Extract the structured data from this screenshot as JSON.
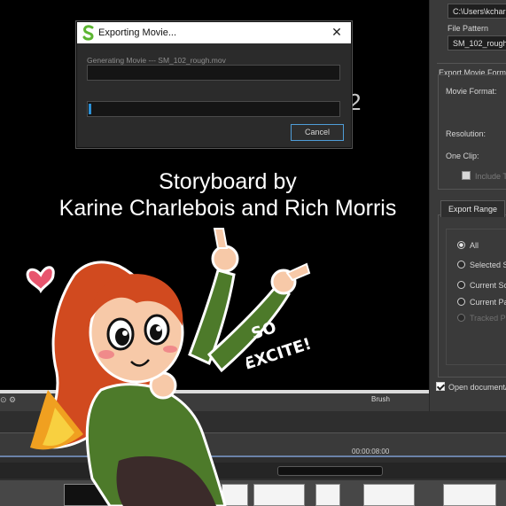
{
  "dialog": {
    "title": "Exporting Movie...",
    "status": "Generating Movie --- SM_102_rough.mov",
    "progress_primary": 0,
    "progress_secondary": 0.01,
    "cancel_label": "Cancel"
  },
  "viewer": {
    "credit_line1": "Storyboard by",
    "credit_line2": "Karine Charlebois and Rich Morris",
    "background_digit": "2"
  },
  "sticker": {
    "caption_line1": "SO",
    "caption_line2": "EXCITE!"
  },
  "export_panel": {
    "path_value": "C:\\Users\\kcharle",
    "file_pattern_label": "File Pattern",
    "file_pattern_value": "SM_102_rough",
    "export_movie_format_label": "Export Movie Forma",
    "movie_format_label": "Movie Format:",
    "resolution_label": "Resolution:",
    "one_clip_label": "One Clip:",
    "include_label": "Include T",
    "export_range_tab": "Export Range",
    "range_options": [
      {
        "label": "All",
        "checked": true,
        "enabled": true
      },
      {
        "label": "Selected S",
        "checked": false,
        "enabled": true
      },
      {
        "label": "Current Sc",
        "checked": false,
        "enabled": true
      },
      {
        "label": "Current Pa",
        "checked": false,
        "enabled": true
      },
      {
        "label": "Tracked Pa",
        "checked": false,
        "enabled": false
      }
    ],
    "open_document_label": "Open document/",
    "open_document_checked": true
  },
  "timeline": {
    "tool_label": "Brush",
    "timecode": "00:00:08:00"
  },
  "colors": {
    "progress": "#2c8fd4",
    "cancel_border": "#4f9dd8",
    "ruler": "#6b82a8"
  }
}
